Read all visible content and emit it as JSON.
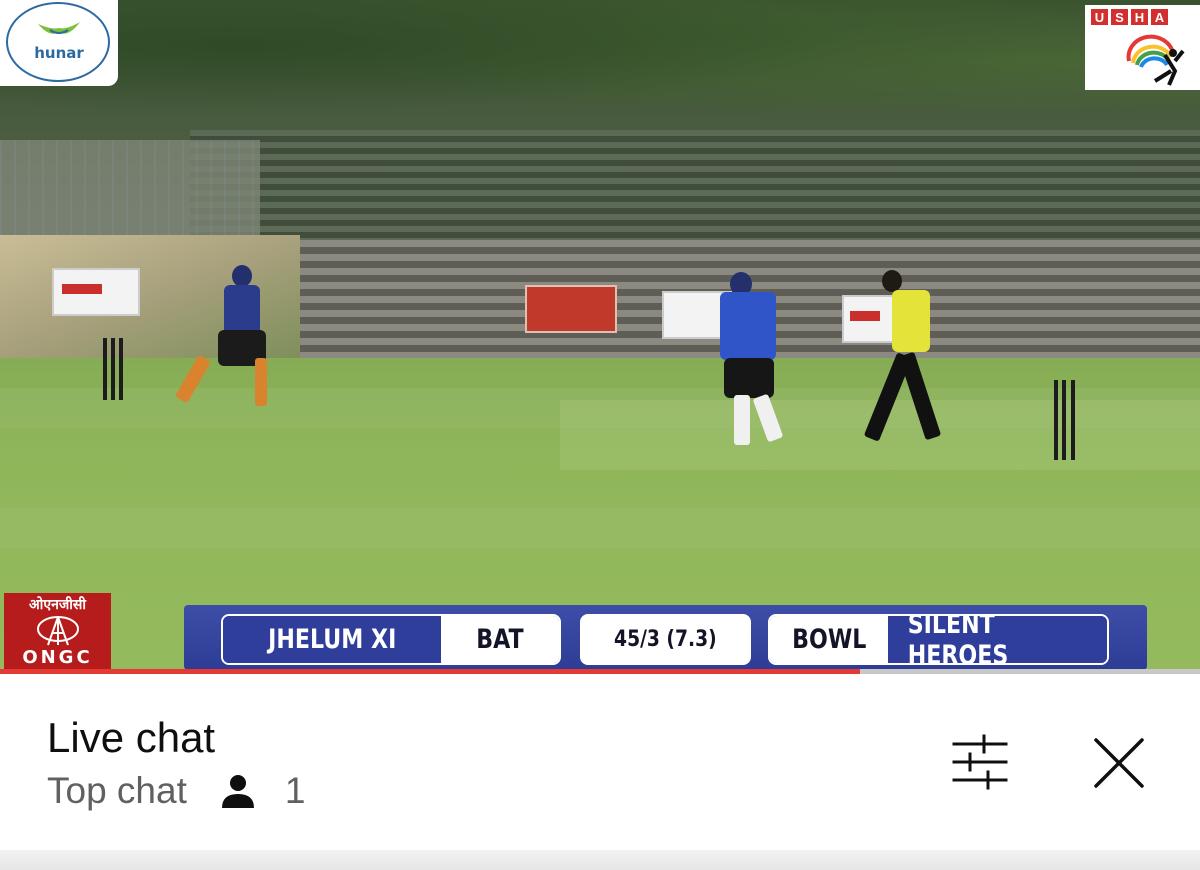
{
  "video": {
    "scoreboard": {
      "batting_team": "JHELUM XI",
      "batting_label": "BAT",
      "score": "45/3 (7.3)",
      "bowling_label": "BOWL",
      "bowling_team": "SILENT HEROES"
    },
    "logos": {
      "top_left_text": "hunar",
      "top_right_letters": [
        "U",
        "S",
        "H",
        "A"
      ],
      "ongc_hindi": "ओएनजीसी",
      "ongc_english": "ONGC"
    },
    "progress_fraction": 0.717
  },
  "chat": {
    "title": "Live chat",
    "mode": "Top chat",
    "viewer_count": "1",
    "icons": {
      "viewer": "person-icon",
      "filter": "sliders-icon",
      "close": "close-icon"
    }
  },
  "colors": {
    "scoreboard_blue": "#2f3e9b",
    "progress_red": "#e53935",
    "ongc_red": "#b71c1c",
    "usha_red": "#d32f2f"
  }
}
